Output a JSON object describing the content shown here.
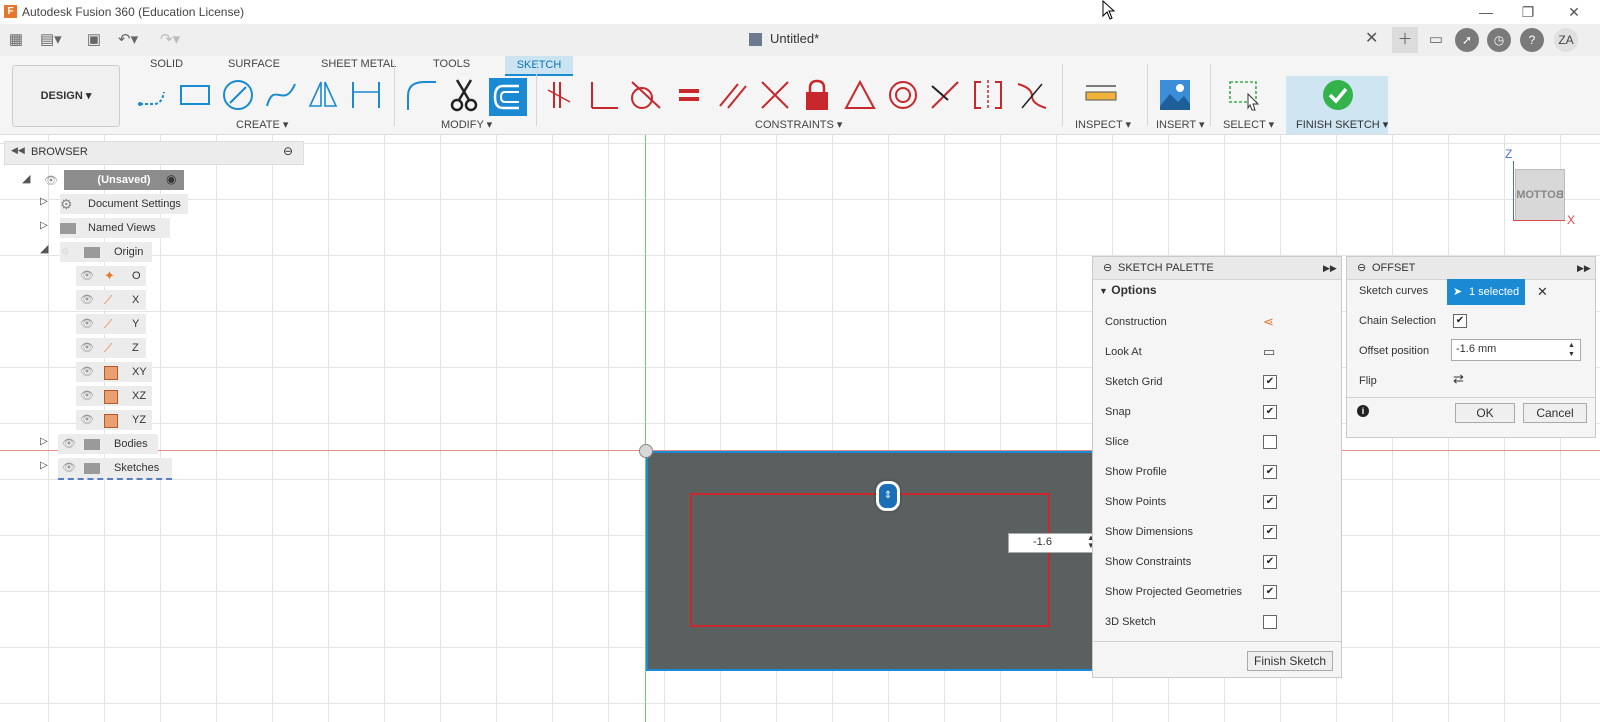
{
  "window": {
    "title": "Autodesk Fusion 360 (Education License)",
    "min": "—",
    "max": "❐",
    "close": "✕"
  },
  "qat": {
    "doc_title": "Untitled*",
    "tab_close": "✕",
    "user_initials": "ZA"
  },
  "ribbon": {
    "tabs": [
      "SOLID",
      "SURFACE",
      "SHEET METAL",
      "TOOLS",
      "SKETCH"
    ],
    "workspace": "DESIGN ▾",
    "groups": {
      "create": "CREATE ▾",
      "modify": "MODIFY ▾",
      "constraints": "CONSTRAINTS ▾",
      "inspect": "INSPECT ▾",
      "insert": "INSERT ▾",
      "select": "SELECT ▾",
      "finish": "FINISH SKETCH ▾"
    }
  },
  "browser": {
    "title": "BROWSER",
    "root": "(Unsaved)",
    "items": [
      "Document Settings",
      "Named Views",
      "Origin",
      "O",
      "X",
      "Y",
      "Z",
      "XY",
      "XZ",
      "YZ",
      "Bodies",
      "Sketches"
    ]
  },
  "viewcube": {
    "face": "BOTTOM",
    "z": "Z",
    "x": "X"
  },
  "canvas": {
    "dim_value": "-1.6"
  },
  "sketch_palette": {
    "title": "SKETCH PALETTE",
    "section": "Options",
    "options": [
      {
        "label": "Construction",
        "kind": "icon"
      },
      {
        "label": "Look At",
        "kind": "icon"
      },
      {
        "label": "Sketch Grid",
        "kind": "check",
        "checked": true
      },
      {
        "label": "Snap",
        "kind": "check",
        "checked": true
      },
      {
        "label": "Slice",
        "kind": "check",
        "checked": false
      },
      {
        "label": "Show Profile",
        "kind": "check",
        "checked": true
      },
      {
        "label": "Show Points",
        "kind": "check",
        "checked": true
      },
      {
        "label": "Show Dimensions",
        "kind": "check",
        "checked": true
      },
      {
        "label": "Show Constraints",
        "kind": "check",
        "checked": true
      },
      {
        "label": "Show Projected Geometries",
        "kind": "check",
        "checked": true
      },
      {
        "label": "3D Sketch",
        "kind": "check",
        "checked": false
      }
    ],
    "finish_button": "Finish Sketch"
  },
  "offset": {
    "title": "OFFSET",
    "sketch_curves_label": "Sketch curves",
    "sketch_curves_value": "1 selected",
    "chain_label": "Chain Selection",
    "chain_checked": true,
    "position_label": "Offset position",
    "position_value": "-1.6 mm",
    "flip_label": "Flip",
    "ok": "OK",
    "cancel": "Cancel"
  },
  "colors": {
    "accent": "#1a8ad4",
    "sketch_red": "#c8282b",
    "body_gray": "#5a5f5f",
    "finish_green": "#34b34a"
  }
}
